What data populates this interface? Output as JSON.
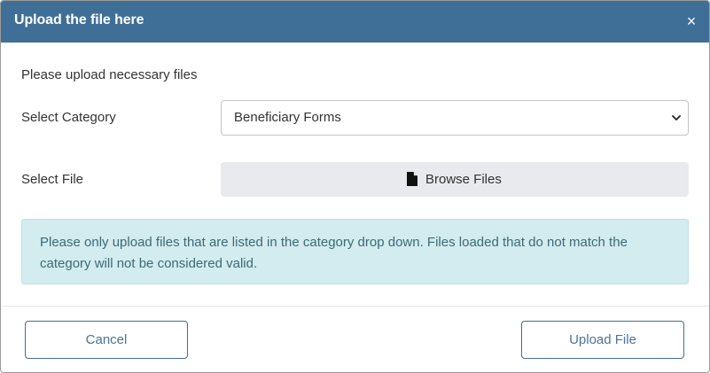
{
  "modal": {
    "title": "Upload the file here",
    "close_glyph": "×"
  },
  "body": {
    "intro": "Please upload necessary files",
    "category_label": "Select Category",
    "category_selected": "Beneficiary Forms",
    "file_label": "Select File",
    "browse_label": "Browse Files",
    "browse_icon": "file-icon",
    "notice": "Please only upload files that are listed in the category drop down. Files loaded that do not match the category will not be considered valid."
  },
  "footer": {
    "cancel_label": "Cancel",
    "upload_label": "Upload File"
  },
  "colors": {
    "header_bg": "#3f6f96",
    "info_bg": "#d2ecef",
    "info_text": "#3e6a76",
    "button_border": "#3f6f96"
  }
}
